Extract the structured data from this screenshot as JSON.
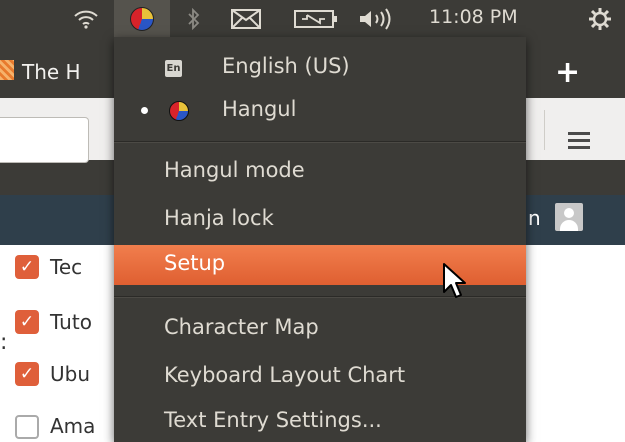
{
  "panel": {
    "clock": "11:08 PM",
    "icons": [
      "wifi-icon",
      "keyboard-input-icon",
      "bluetooth-icon",
      "mail-icon",
      "battery-icon",
      "volume-icon",
      "settings-gear-icon"
    ]
  },
  "browser": {
    "tab_title": "The H",
    "new_tab_label": "+",
    "darkbar_letter": "n",
    "checkboxes": [
      {
        "label": "Tec",
        "checked": true
      },
      {
        "label": "Tuto",
        "checked": true
      },
      {
        "label": "Ubu",
        "checked": true
      },
      {
        "label": "Ama",
        "checked": false
      }
    ],
    "stray_mark": ":"
  },
  "menu": {
    "input_sources": [
      {
        "label": "English (US)",
        "badge": "En",
        "selected": false
      },
      {
        "label": "Hangul",
        "selected": true
      }
    ],
    "items_group1": [
      "Hangul mode",
      "Hanja lock",
      "Setup"
    ],
    "highlighted": "Setup",
    "items_group2": [
      "Character Map",
      "Keyboard Layout Chart",
      "Text Entry Settings..."
    ]
  },
  "colors": {
    "panel_bg": "#3c3b37",
    "highlight": "#e8693c",
    "checkbox_accent": "#df5f3a",
    "darkbar": "#2f3f4b"
  }
}
